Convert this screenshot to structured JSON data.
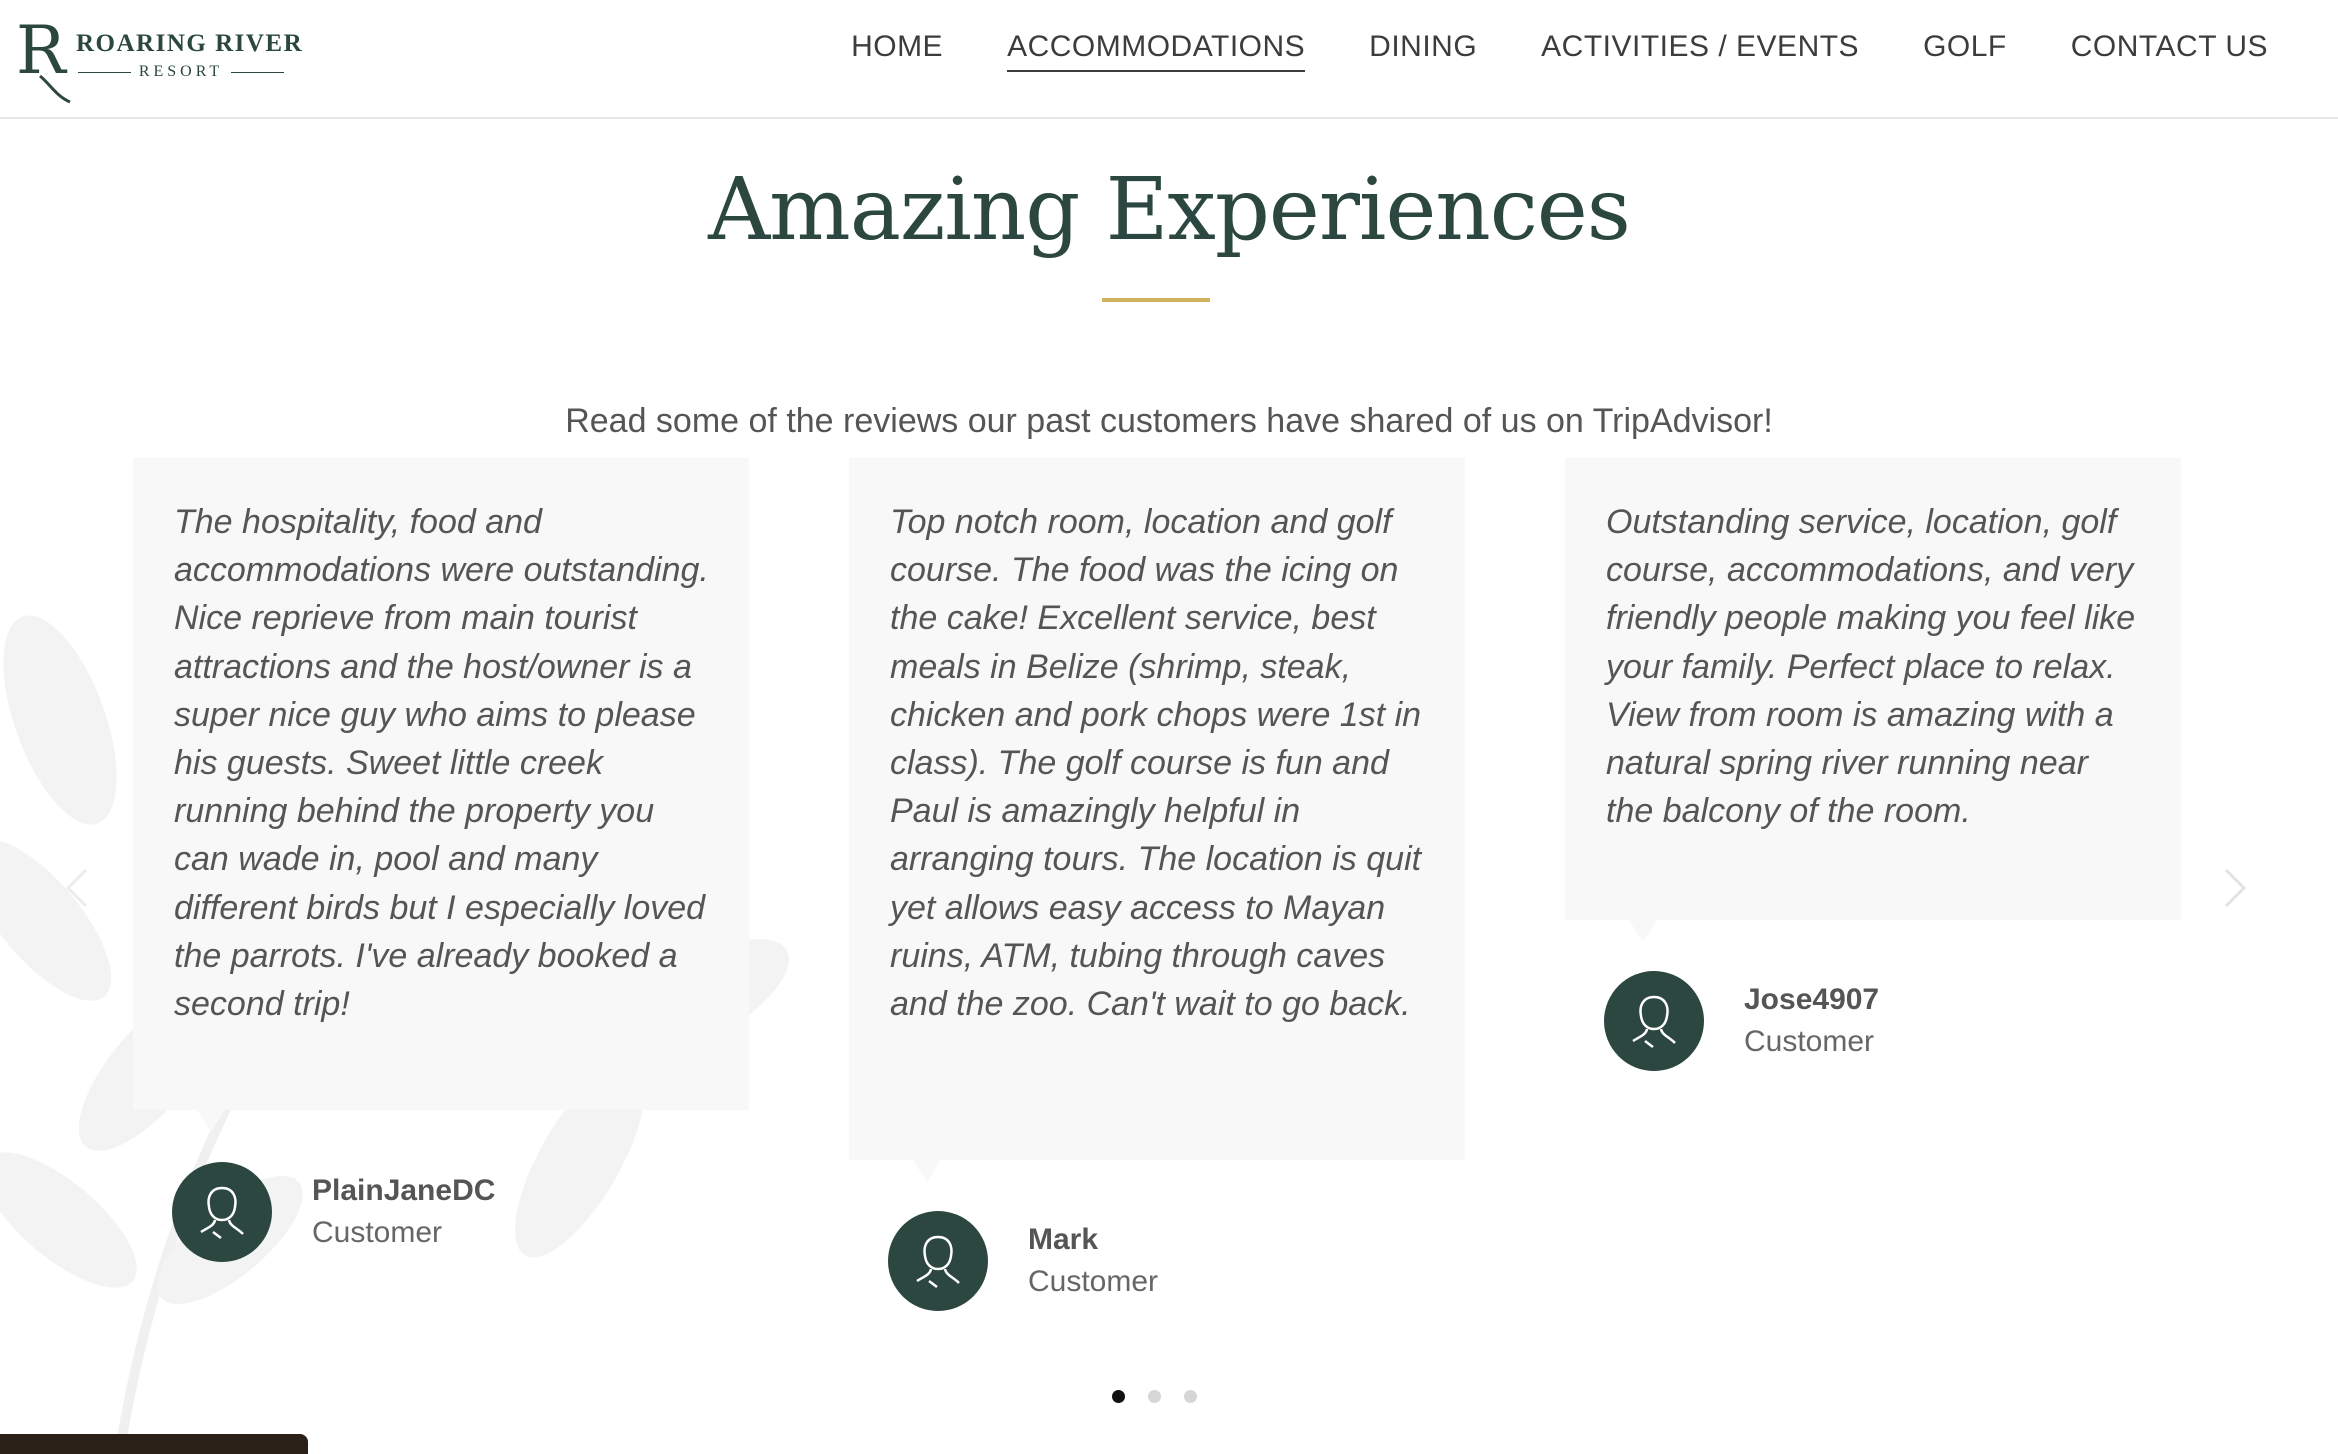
{
  "brand": {
    "logo_letter": "R",
    "name": "ROARING RIVER",
    "sub": "RESORT"
  },
  "nav": {
    "items": [
      {
        "label": "HOME"
      },
      {
        "label": "ACCOMMODATIONS",
        "active": true
      },
      {
        "label": "DINING"
      },
      {
        "label": "ACTIVITIES / EVENTS"
      },
      {
        "label": "GOLF"
      },
      {
        "label": "CONTACT US"
      }
    ]
  },
  "section": {
    "title": "Amazing Experiences",
    "intro": "Read some of the reviews our past customers have shared of us on TripAdvisor!"
  },
  "reviews": [
    {
      "text": "The hospitality, food and accommodations were outstanding. Nice reprieve from main tourist attractions and the host/owner is a super nice guy who aims to please his guests. Sweet little creek running behind the property you can wade in, pool and many different birds but I especially loved the parrots. I've already booked a second trip!",
      "name": "PlainJaneDC",
      "role": "Customer"
    },
    {
      "text": "Top notch room, location and golf course. The food was the icing on the cake! Excellent service, best meals in Belize (shrimp, steak, chicken and pork chops were 1st in class). The golf course is fun and Paul is amazingly helpful in arranging tours. The location is quit yet allows easy access to Mayan ruins, ATM, tubing through caves and the zoo. Can't wait to go back.",
      "name": "Mark",
      "role": "Customer"
    },
    {
      "text": "Outstanding service, location, golf course, accommodations, and very friendly people making you feel like your family. Perfect place to relax. View from room is amazing with a natural spring river running near the balcony of the room.",
      "name": "Jose4907",
      "role": "Customer"
    }
  ],
  "carousel": {
    "prev_icon": "chevron-left-icon",
    "next_icon": "chevron-right-icon",
    "active_slide": 1,
    "slide_count": 3
  },
  "colors": {
    "brand_green": "#2b4740",
    "accent_gold": "#d0b15e",
    "card_bg": "#f8f8f8"
  }
}
